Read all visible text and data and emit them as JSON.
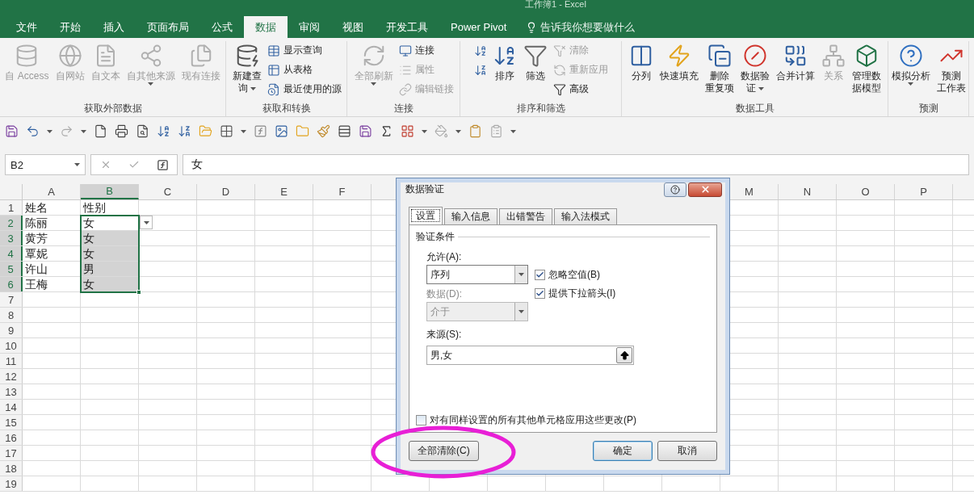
{
  "window": {
    "title": "工作簿1 - Excel"
  },
  "ribbon_tabs": [
    {
      "label": "文件",
      "selected": false
    },
    {
      "label": "开始",
      "selected": false
    },
    {
      "label": "插入",
      "selected": false
    },
    {
      "label": "页面布局",
      "selected": false
    },
    {
      "label": "公式",
      "selected": false
    },
    {
      "label": "数据",
      "selected": true
    },
    {
      "label": "审阅",
      "selected": false
    },
    {
      "label": "视图",
      "selected": false
    },
    {
      "label": "开发工具",
      "selected": false
    },
    {
      "label": "Power Pivot",
      "selected": false
    }
  ],
  "tell_me": {
    "placeholder": "告诉我你想要做什么"
  },
  "ribbon_groups": [
    {
      "label": "获取外部数据",
      "items": [
        {
          "kind": "large",
          "lines": [
            "自 Access"
          ],
          "disabled": true,
          "menu": false
        },
        {
          "kind": "large",
          "lines": [
            "自网站"
          ],
          "disabled": true,
          "menu": false
        },
        {
          "kind": "large",
          "lines": [
            "自文本"
          ],
          "disabled": true,
          "menu": false
        },
        {
          "kind": "large",
          "lines": [
            "自其他来源"
          ],
          "disabled": true,
          "menu": true
        },
        {
          "kind": "large",
          "lines": [
            "现有连接"
          ],
          "disabled": true,
          "menu": false
        }
      ]
    },
    {
      "label": "获取和转换",
      "items": [
        {
          "kind": "large",
          "lines": [
            "新建查",
            "询"
          ],
          "disabled": false,
          "menu": true
        },
        {
          "kind": "stack",
          "buttons": [
            {
              "label": "显示查询",
              "disabled": false
            },
            {
              "label": "从表格",
              "disabled": false
            },
            {
              "label": "最近使用的源",
              "disabled": false
            }
          ]
        }
      ]
    },
    {
      "label": "连接",
      "items": [
        {
          "kind": "large",
          "lines": [
            "全部刷新"
          ],
          "disabled": true,
          "menu": true
        },
        {
          "kind": "stack",
          "buttons": [
            {
              "label": "连接",
              "disabled": false
            },
            {
              "label": "属性",
              "disabled": true
            },
            {
              "label": "编辑链接",
              "disabled": true
            }
          ]
        }
      ]
    },
    {
      "label": "排序和筛选",
      "items": [
        {
          "kind": "stack",
          "buttons": [
            {
              "disabled": false
            },
            {
              "disabled": false
            }
          ]
        },
        {
          "kind": "large",
          "lines": [
            "排序"
          ],
          "disabled": false,
          "menu": false
        },
        {
          "kind": "large",
          "lines": [
            "筛选"
          ],
          "disabled": false,
          "menu": false
        },
        {
          "kind": "stack",
          "buttons": [
            {
              "label": "清除",
              "disabled": true
            },
            {
              "label": "重新应用",
              "disabled": true
            },
            {
              "label": "高级",
              "disabled": false
            }
          ]
        }
      ]
    },
    {
      "label": "数据工具",
      "items": [
        {
          "kind": "large",
          "lines": [
            "分列"
          ],
          "disabled": false,
          "menu": false
        },
        {
          "kind": "large",
          "lines": [
            "快速填充"
          ],
          "disabled": false,
          "menu": false
        },
        {
          "kind": "large",
          "lines": [
            "删除",
            "重复项"
          ],
          "disabled": false,
          "menu": false
        },
        {
          "kind": "large",
          "lines": [
            "数据验",
            "证"
          ],
          "disabled": false,
          "menu": true
        },
        {
          "kind": "large",
          "lines": [
            "合并计算"
          ],
          "disabled": false,
          "menu": false
        },
        {
          "kind": "large",
          "lines": [
            "关系"
          ],
          "disabled": true,
          "menu": false
        },
        {
          "kind": "large",
          "lines": [
            "管理数",
            "据模型"
          ],
          "disabled": false,
          "menu": false
        }
      ]
    },
    {
      "label": "预测",
      "items": [
        {
          "kind": "large",
          "lines": [
            "模拟分析"
          ],
          "disabled": false,
          "menu": true
        },
        {
          "kind": "large",
          "lines": [
            "预测",
            "工作表"
          ],
          "disabled": false,
          "menu": false
        }
      ]
    }
  ],
  "formula_bar": {
    "name_box": "B2",
    "formula": "女"
  },
  "sheet": {
    "columns": [
      {
        "label": "A",
        "selected": false
      },
      {
        "label": "B",
        "selected": true
      },
      {
        "label": "C",
        "selected": false
      },
      {
        "label": "D",
        "selected": false
      },
      {
        "label": "E",
        "selected": false
      },
      {
        "label": "F",
        "selected": false
      },
      {
        "label": "M",
        "selected": false
      },
      {
        "label": "N",
        "selected": false
      },
      {
        "label": "O",
        "selected": false
      },
      {
        "label": "P",
        "selected": false
      }
    ],
    "rows": [
      {
        "header": "1",
        "selected": false,
        "cells": [
          {
            "text": "姓名",
            "selected": false
          },
          {
            "text": "性别",
            "selected": false
          }
        ]
      },
      {
        "header": "2",
        "selected": true,
        "cells": [
          {
            "text": "陈丽",
            "selected": false
          },
          {
            "text": "女",
            "selected": false
          }
        ]
      },
      {
        "header": "3",
        "selected": true,
        "cells": [
          {
            "text": "黄芳",
            "selected": false
          },
          {
            "text": "女",
            "selected": true
          }
        ]
      },
      {
        "header": "4",
        "selected": true,
        "cells": [
          {
            "text": "覃妮",
            "selected": false
          },
          {
            "text": "女",
            "selected": true
          }
        ]
      },
      {
        "header": "5",
        "selected": true,
        "cells": [
          {
            "text": "许山",
            "selected": false
          },
          {
            "text": "男",
            "selected": true
          }
        ]
      },
      {
        "header": "6",
        "selected": true,
        "cells": [
          {
            "text": "王梅",
            "selected": false
          },
          {
            "text": "女",
            "selected": true
          }
        ]
      },
      {
        "header": "7",
        "selected": false
      },
      {
        "header": "8",
        "selected": false
      },
      {
        "header": "9",
        "selected": false
      },
      {
        "header": "10",
        "selected": false
      },
      {
        "header": "11",
        "selected": false
      },
      {
        "header": "12",
        "selected": false
      },
      {
        "header": "13",
        "selected": false
      },
      {
        "header": "14",
        "selected": false
      },
      {
        "header": "15",
        "selected": false
      },
      {
        "header": "16",
        "selected": false
      },
      {
        "header": "17",
        "selected": false
      },
      {
        "header": "18",
        "selected": false
      },
      {
        "header": "19",
        "selected": false
      }
    ]
  },
  "dialog": {
    "title": "数据验证",
    "tabs": [
      {
        "label": "设置",
        "selected": true
      },
      {
        "label": "输入信息",
        "selected": false
      },
      {
        "label": "出错警告",
        "selected": false
      },
      {
        "label": "输入法模式",
        "selected": false
      }
    ],
    "section": "验证条件",
    "allow": {
      "label": "允许(A):",
      "value": "序列"
    },
    "options": [
      {
        "label": "忽略空值(B)",
        "checked": true
      },
      {
        "label": "提供下拉箭头(I)",
        "checked": true
      }
    ],
    "data": {
      "label": "数据(D):",
      "value": "介于",
      "disabled": true
    },
    "source": {
      "label": "来源(S):",
      "value": "男,女"
    },
    "apply_all": {
      "label": "对有同样设置的所有其他单元格应用这些更改(P)",
      "checked": false
    },
    "buttons": [
      {
        "label": "全部清除(C)",
        "kind": "left"
      },
      {
        "label": "确定",
        "kind": "default"
      },
      {
        "label": "取消",
        "kind": "normal"
      }
    ]
  }
}
